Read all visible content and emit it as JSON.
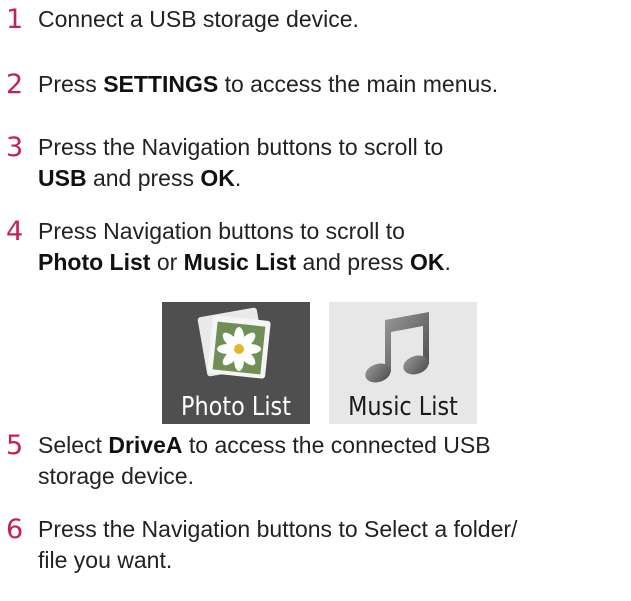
{
  "steps": [
    {
      "number": "1",
      "line1": {
        "pre": "Connect a USB storage device."
      }
    },
    {
      "number": "2",
      "line1": {
        "pre": "Press ",
        "bold1": "SETTINGS",
        "post": " to access the main menus."
      }
    },
    {
      "number": "3",
      "line1": {
        "pre": "Press the Navigation buttons to scroll to"
      },
      "line2": {
        "bold1": "USB",
        "mid": " and press ",
        "bold2": "OK",
        "post": "."
      }
    },
    {
      "number": "4",
      "line1": {
        "pre": "Press Navigation buttons to scroll to"
      },
      "line2": {
        "bold1": "Photo List",
        "mid": " or ",
        "bold2": "Music List",
        "mid2": " and press ",
        "bold3": "OK",
        "post": "."
      }
    },
    {
      "number": "5",
      "line1": {
        "pre": "Select ",
        "bold1": "DriveA",
        "post": " to access the connected USB"
      },
      "line2": {
        "pre": "storage device."
      }
    },
    {
      "number": "6",
      "line1": {
        "pre": "Press the Navigation buttons to Select a folder/"
      },
      "line2": {
        "pre": "file you want."
      }
    }
  ],
  "tiles": {
    "photo": {
      "label": "Photo List",
      "icon": "photo-icon"
    },
    "music": {
      "label": "Music List",
      "icon": "music-note-icon"
    }
  },
  "colors": {
    "step_number": "#c4215a",
    "photo_tile": "#4f4f4f",
    "music_tile": "#e7e7e7"
  }
}
